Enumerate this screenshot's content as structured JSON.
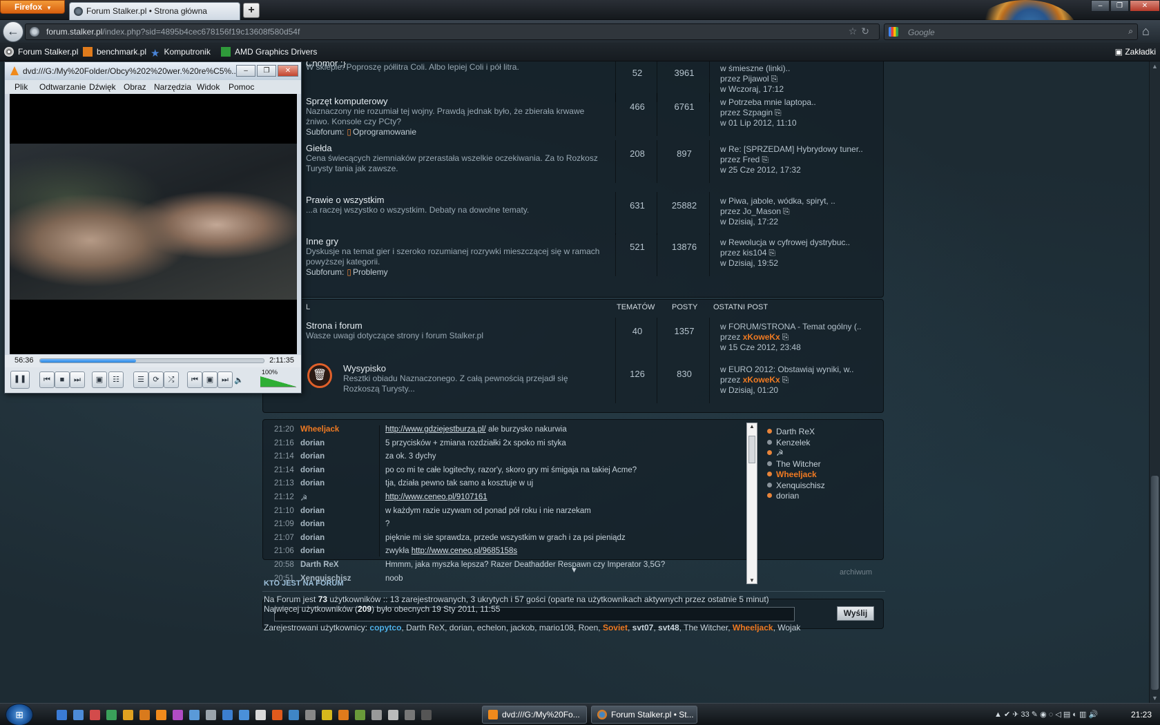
{
  "browser": {
    "menu_label": "Firefox",
    "tab_title": "Forum Stalker.pl • Strona główna",
    "new_tab": "+",
    "url_host": "forum.stalker.pl",
    "url_rest": "/index.php?sid=4895b4cec678156f19c13608f580d54f",
    "search_placeholder": "Google",
    "bookmarks": [
      "Forum Stalker.pl",
      "benchmark.pl",
      "Komputronik",
      "AMD Graphics Drivers"
    ],
    "bookmarks_menu": "Zakładki"
  },
  "forum": {
    "partial_title": "Chomor :}",
    "rows": [
      {
        "title": "",
        "desc": "W sklepie: Poproszę półlitra Coli. Albo lepiej Coli i pół litra.",
        "sub_label": "",
        "sub_item": "",
        "topics": "52",
        "posts": "3961",
        "last_in": "w śmieszne (linki)..",
        "last_by": "przez Pijawol",
        "last_at": "w Wczoraj, 17:12"
      },
      {
        "title": "Sprzęt komputerowy",
        "desc": "Naznaczony nie rozumiał tej wojny. Prawdą jednak było, że zbierała krwawe żniwo. Konsole czy PCty?",
        "sub_label": "Subforum:",
        "sub_item": "Oprogramowanie",
        "topics": "466",
        "posts": "6761",
        "last_in": "w Potrzeba mnie laptopa..",
        "last_by": "przez Szpagin",
        "last_at": "w 01 Lip 2012, 11:10"
      },
      {
        "title": "Giełda",
        "desc": "Cena świecących ziemniaków przerastała wszelkie oczekiwania. Za to Rozkosz Turysty tania jak zawsze.",
        "sub_label": "",
        "sub_item": "",
        "topics": "208",
        "posts": "897",
        "last_in": "w Re: [SPRZEDAM] Hybrydowy tuner..",
        "last_by": "przez Fred",
        "last_at": "w 25 Cze 2012, 17:32"
      },
      {
        "title": "Prawie o wszystkim",
        "desc": "...a raczej wszystko o wszystkim. Debaty na dowolne tematy.",
        "sub_label": "",
        "sub_item": "",
        "topics": "631",
        "posts": "25882",
        "last_in": "w Piwa, jabole, wódka, spiryt, ..",
        "last_by": "przez Jo_Mason",
        "last_at": "w Dzisiaj, 17:22"
      },
      {
        "title": "Inne gry",
        "desc": "Dyskusje na temat gier i szeroko rozumianej rozrywki mieszczącej się w ramach powyższej kategorii.",
        "sub_label": "Subforum:",
        "sub_item": "Problemy",
        "topics": "521",
        "posts": "13876",
        "last_in": "w Rewolucja w cyfrowej dystrybuc..",
        "last_by": "przez kis104",
        "last_at": "w Dzisiaj, 19:52"
      }
    ],
    "section2": {
      "col_partial": "L",
      "col_topics": "TEMATÓW",
      "col_posts": "POSTY",
      "col_last": "OSTATNI POST"
    },
    "rows2": [
      {
        "title": "Strona i forum",
        "desc": "Wasze uwagi dotyczące strony i forum Stalker.pl",
        "topics": "40",
        "posts": "1357",
        "last_in": "w FORUM/STRONA - Temat ogólny (..",
        "last_by_prefix": "przez",
        "last_by": "xKoweKx",
        "last_at": "w 15 Cze 2012, 23:48"
      },
      {
        "title": "Wysypisko",
        "desc": "Resztki obiadu Naznaczonego. Z całą pewnością przejadł się Rozkoszą Turysty...",
        "topics": "126",
        "posts": "830",
        "last_in": "w EURO 2012: Obstawiaj wyniki, w..",
        "last_by_prefix": "przez",
        "last_by": "xKoweKx",
        "last_at": "w Dzisiaj, 01:20"
      }
    ]
  },
  "chat": {
    "messages": [
      {
        "time": "21:20",
        "user": "Wheeljack",
        "orange": true,
        "link": "http://www.gdziejestburza.pl/",
        "text": " ale burzysko nakurwia"
      },
      {
        "time": "21:16",
        "user": "dorian",
        "orange": false,
        "link": "",
        "text": "5 przycisków + zmiana rozdziałki 2x spoko mi styka"
      },
      {
        "time": "21:14",
        "user": "dorian",
        "orange": false,
        "link": "",
        "text": "za ok. 3 dychy"
      },
      {
        "time": "21:14",
        "user": "dorian",
        "orange": false,
        "link": "",
        "text": "po co mi te całe logitechy, razor'y, skoro gry mi śmigaja na takiej Acme?"
      },
      {
        "time": "21:13",
        "user": "dorian",
        "orange": false,
        "link": "",
        "text": "tja, działa pewno tak samo a kosztuje w uj"
      },
      {
        "time": "21:12",
        "user": "☭",
        "orange": false,
        "link": "http://www.ceneo.pl/9107161",
        "text": ""
      },
      {
        "time": "21:10",
        "user": "dorian",
        "orange": false,
        "link": "",
        "text": "w każdym razie uzywam od ponad pół roku i nie narzekam"
      },
      {
        "time": "21:09",
        "user": "dorian",
        "orange": false,
        "link": "",
        "text": "?"
      },
      {
        "time": "21:07",
        "user": "dorian",
        "orange": false,
        "link": "",
        "text": "pięknie mi sie sprawdza, przede wszystkim w grach i za psi pieniądz"
      },
      {
        "time": "21:06",
        "user": "dorian",
        "orange": false,
        "link": "http://www.ceneo.pl/9685158s",
        "text": "zwykła ",
        "link_after": true
      },
      {
        "time": "20:58",
        "user": "Darth ReX",
        "orange": false,
        "link": "",
        "text": "Hmmm, jaka myszka lepsza? Razer Deathadder Respawn czy Imperator 3,5G?"
      },
      {
        "time": "20:51",
        "user": "Xenquischisz",
        "orange": false,
        "link": "",
        "text": "noob"
      }
    ],
    "online": [
      {
        "name": "Darth ReX",
        "orange": false,
        "dot": "#e8843a"
      },
      {
        "name": "Kenzelek",
        "orange": false,
        "dot": "#8a949c"
      },
      {
        "name": "☭",
        "orange": false,
        "dot": "#e8843a"
      },
      {
        "name": "The Witcher",
        "orange": false,
        "dot": "#8a949c"
      },
      {
        "name": "Wheeljack",
        "orange": true,
        "dot": "#e8843a"
      },
      {
        "name": "Xenquischisz",
        "orange": false,
        "dot": "#8a949c"
      },
      {
        "name": "dorian",
        "orange": false,
        "dot": "#e8843a"
      }
    ],
    "send_label": "Wyślij",
    "archive_label": "archiwum"
  },
  "who": {
    "title": "KTO JEST NA FORUM",
    "line1_a": "Na Forum jest ",
    "line1_count": "73",
    "line1_b": " użytkowników :: 13 zarejestrowanych, 3 ukrytych i 57 gości (oparte na użytkownikach aktywnych przez ostatnie 5 minut)",
    "line2_a": "Najwięcej użytkowników (",
    "line2_count": "209",
    "line2_b": ") było obecnych 19 Sty 2011, 11:55",
    "reg_label": "Zarejestrowani użytkownicy: ",
    "users": [
      {
        "name": "copytco",
        "style": "blue"
      },
      {
        "name": "Darth ReX",
        "style": ""
      },
      {
        "name": "dorian",
        "style": ""
      },
      {
        "name": "echelon",
        "style": ""
      },
      {
        "name": "jackob",
        "style": ""
      },
      {
        "name": "mario108",
        "style": ""
      },
      {
        "name": "Roen",
        "style": ""
      },
      {
        "name": "Soviet",
        "style": "orange"
      },
      {
        "name": "svt07",
        "style": "bold"
      },
      {
        "name": "svt48",
        "style": "bold"
      },
      {
        "name": "The Witcher",
        "style": ""
      },
      {
        "name": "Wheeljack",
        "style": "orange"
      },
      {
        "name": "Wojak",
        "style": ""
      }
    ]
  },
  "vlc": {
    "title": "dvd:///G:/My%20Folder/Obcy%202%20wer.%20re%C5%...",
    "menu": [
      "Plik",
      "Odtwarzanie",
      "Dźwięk",
      "Obraz",
      "Narzędzia",
      "Widok",
      "Pomoc"
    ],
    "elapsed": "56:36",
    "total": "2:11:35",
    "progress": 0.43,
    "volume": "100%"
  },
  "taskbar": {
    "tasks": [
      "dvd:///G:/My%20Fo...",
      "Forum Stalker.pl • St..."
    ],
    "tray_count": "33",
    "clock": "21:23"
  }
}
